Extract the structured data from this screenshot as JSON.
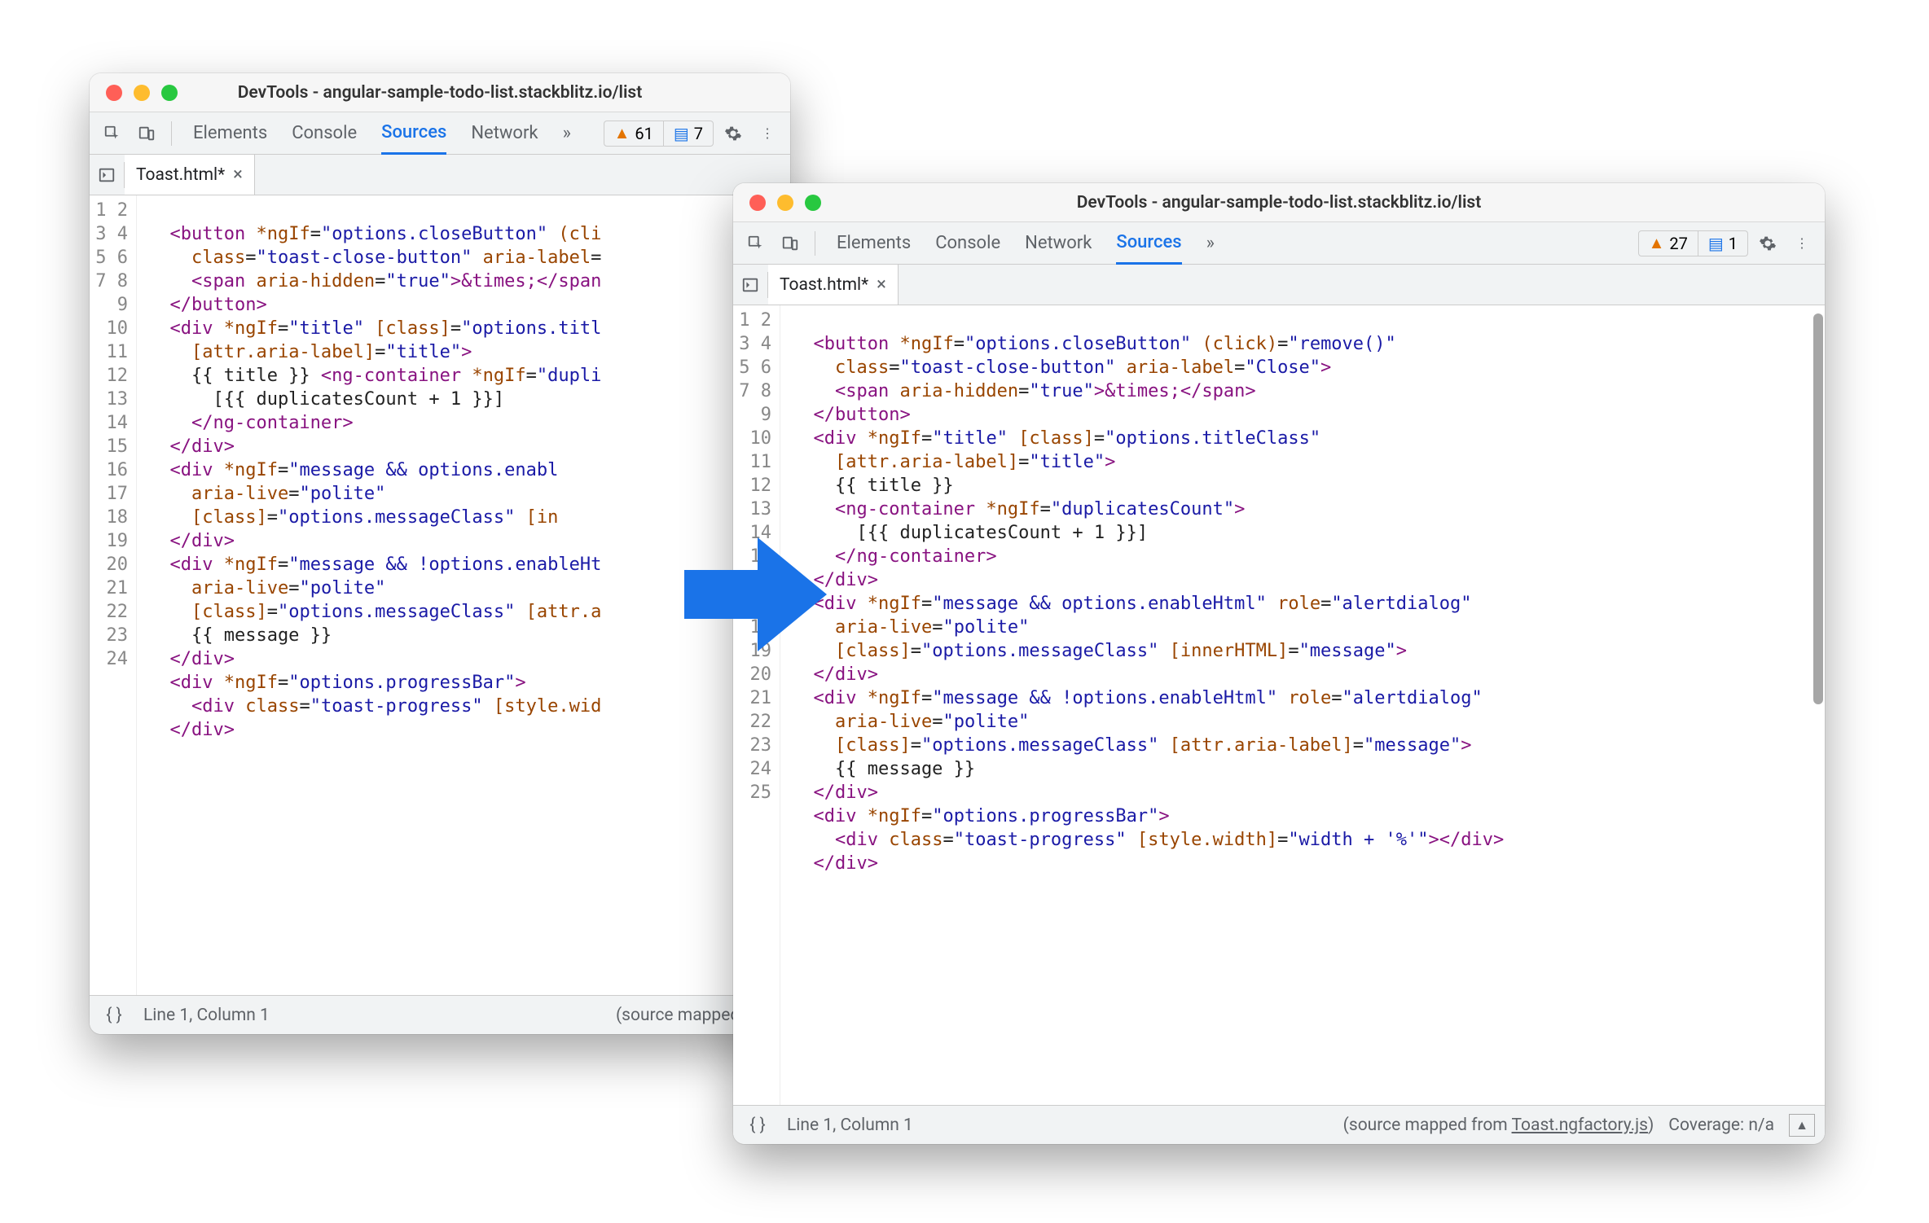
{
  "left": {
    "title": "DevTools - angular-sample-todo-list.stackblitz.io/list",
    "tabs": [
      "Elements",
      "Console",
      "Sources",
      "Network"
    ],
    "activeTab": "Sources",
    "overflow": "»",
    "warnCount": "61",
    "msgCount": "7",
    "fileTab": "Toast.html*",
    "status": {
      "cursor": "Line 1, Column 1",
      "mapped": "(source mapped from "
    },
    "lines": 24,
    "code": [
      [],
      [
        [
          "txt",
          "  "
        ],
        [
          "tag",
          "<button"
        ],
        [
          "txt",
          " "
        ],
        [
          "attr",
          "*ngIf"
        ],
        [
          "txt",
          "="
        ],
        [
          "str",
          "\"options.closeButton\""
        ],
        [
          "txt",
          " "
        ],
        [
          "attr",
          "(cli"
        ]
      ],
      [
        [
          "txt",
          "    "
        ],
        [
          "attr",
          "class"
        ],
        [
          "txt",
          "="
        ],
        [
          "str",
          "\"toast-close-button\""
        ],
        [
          "txt",
          " "
        ],
        [
          "attr",
          "aria-label"
        ],
        [
          "txt",
          "="
        ]
      ],
      [
        [
          "txt",
          "    "
        ],
        [
          "tag",
          "<span"
        ],
        [
          "txt",
          " "
        ],
        [
          "attr",
          "aria-hidden"
        ],
        [
          "txt",
          "="
        ],
        [
          "str",
          "\"true\""
        ],
        [
          "tag",
          ">"
        ],
        [
          "ent",
          "&times;"
        ],
        [
          "tag",
          "</span"
        ]
      ],
      [
        [
          "txt",
          "  "
        ],
        [
          "tag",
          "</button>"
        ]
      ],
      [
        [
          "txt",
          "  "
        ],
        [
          "tag",
          "<div"
        ],
        [
          "txt",
          " "
        ],
        [
          "attr",
          "*ngIf"
        ],
        [
          "txt",
          "="
        ],
        [
          "str",
          "\"title\""
        ],
        [
          "txt",
          " "
        ],
        [
          "attr",
          "[class]"
        ],
        [
          "txt",
          "="
        ],
        [
          "str",
          "\"options.titl"
        ]
      ],
      [
        [
          "txt",
          "    "
        ],
        [
          "attr",
          "[attr.aria-label]"
        ],
        [
          "txt",
          "="
        ],
        [
          "str",
          "\"title\""
        ],
        [
          "tag",
          ">"
        ]
      ],
      [
        [
          "txt",
          "    {{ title }} "
        ],
        [
          "tag",
          "<ng-container"
        ],
        [
          "txt",
          " "
        ],
        [
          "attr",
          "*ngIf"
        ],
        [
          "txt",
          "="
        ],
        [
          "str",
          "\"dupli"
        ]
      ],
      [
        [
          "txt",
          "      [{{ duplicatesCount + 1 }}]"
        ]
      ],
      [
        [
          "txt",
          "    "
        ],
        [
          "tag",
          "</ng-container>"
        ]
      ],
      [
        [
          "txt",
          "  "
        ],
        [
          "tag",
          "</div>"
        ]
      ],
      [
        [
          "txt",
          "  "
        ],
        [
          "tag",
          "<div"
        ],
        [
          "txt",
          " "
        ],
        [
          "attr",
          "*ngIf"
        ],
        [
          "txt",
          "="
        ],
        [
          "str",
          "\"message && options.enabl"
        ]
      ],
      [
        [
          "txt",
          "    "
        ],
        [
          "attr",
          "aria-live"
        ],
        [
          "txt",
          "="
        ],
        [
          "str",
          "\"polite\""
        ]
      ],
      [
        [
          "txt",
          "    "
        ],
        [
          "attr",
          "[class]"
        ],
        [
          "txt",
          "="
        ],
        [
          "str",
          "\"options.messageClass\""
        ],
        [
          "txt",
          " "
        ],
        [
          "attr",
          "[in"
        ]
      ],
      [
        [
          "txt",
          "  "
        ],
        [
          "tag",
          "</div>"
        ]
      ],
      [
        [
          "txt",
          "  "
        ],
        [
          "tag",
          "<div"
        ],
        [
          "txt",
          " "
        ],
        [
          "attr",
          "*ngIf"
        ],
        [
          "txt",
          "="
        ],
        [
          "str",
          "\"message && !options.enableHt"
        ]
      ],
      [
        [
          "txt",
          "    "
        ],
        [
          "attr",
          "aria-live"
        ],
        [
          "txt",
          "="
        ],
        [
          "str",
          "\"polite\""
        ]
      ],
      [
        [
          "txt",
          "    "
        ],
        [
          "attr",
          "[class]"
        ],
        [
          "txt",
          "="
        ],
        [
          "str",
          "\"options.messageClass\""
        ],
        [
          "txt",
          " "
        ],
        [
          "attr",
          "[attr.a"
        ]
      ],
      [
        [
          "txt",
          "    {{ message }}"
        ]
      ],
      [
        [
          "txt",
          "  "
        ],
        [
          "tag",
          "</div>"
        ]
      ],
      [
        [
          "txt",
          "  "
        ],
        [
          "tag",
          "<div"
        ],
        [
          "txt",
          " "
        ],
        [
          "attr",
          "*ngIf"
        ],
        [
          "txt",
          "="
        ],
        [
          "str",
          "\"options.progressBar\""
        ],
        [
          "tag",
          ">"
        ]
      ],
      [
        [
          "txt",
          "    "
        ],
        [
          "tag",
          "<div"
        ],
        [
          "txt",
          " "
        ],
        [
          "attr",
          "class"
        ],
        [
          "txt",
          "="
        ],
        [
          "str",
          "\"toast-progress\""
        ],
        [
          "txt",
          " "
        ],
        [
          "attr",
          "[style.wid"
        ]
      ],
      [
        [
          "txt",
          "  "
        ],
        [
          "tag",
          "</div>"
        ]
      ],
      []
    ]
  },
  "right": {
    "title": "DevTools - angular-sample-todo-list.stackblitz.io/list",
    "tabs": [
      "Elements",
      "Console",
      "Network",
      "Sources"
    ],
    "activeTab": "Sources",
    "overflow": "»",
    "warnCount": "27",
    "msgCount": "1",
    "fileTab": "Toast.html*",
    "status": {
      "cursor": "Line 1, Column 1",
      "mappedPrefix": "(source mapped from ",
      "mappedLink": "Toast.ngfactory.js",
      "mappedSuffix": ")",
      "coverage": "Coverage: n/a"
    },
    "lines": 25,
    "code": [
      [],
      [
        [
          "txt",
          "  "
        ],
        [
          "tag",
          "<button"
        ],
        [
          "txt",
          " "
        ],
        [
          "attr",
          "*ngIf"
        ],
        [
          "txt",
          "="
        ],
        [
          "str",
          "\"options.closeButton\""
        ],
        [
          "txt",
          " "
        ],
        [
          "attr",
          "(click)"
        ],
        [
          "txt",
          "="
        ],
        [
          "str",
          "\"remove()\""
        ]
      ],
      [
        [
          "txt",
          "    "
        ],
        [
          "attr",
          "class"
        ],
        [
          "txt",
          "="
        ],
        [
          "str",
          "\"toast-close-button\""
        ],
        [
          "txt",
          " "
        ],
        [
          "attr",
          "aria-label"
        ],
        [
          "txt",
          "="
        ],
        [
          "str",
          "\"Close\""
        ],
        [
          "tag",
          ">"
        ]
      ],
      [
        [
          "txt",
          "    "
        ],
        [
          "tag",
          "<span"
        ],
        [
          "txt",
          " "
        ],
        [
          "attr",
          "aria-hidden"
        ],
        [
          "txt",
          "="
        ],
        [
          "str",
          "\"true\""
        ],
        [
          "tag",
          ">"
        ],
        [
          "ent",
          "&times;"
        ],
        [
          "tag",
          "</span>"
        ]
      ],
      [
        [
          "txt",
          "  "
        ],
        [
          "tag",
          "</button>"
        ]
      ],
      [
        [
          "txt",
          "  "
        ],
        [
          "tag",
          "<div"
        ],
        [
          "txt",
          " "
        ],
        [
          "attr",
          "*ngIf"
        ],
        [
          "txt",
          "="
        ],
        [
          "str",
          "\"title\""
        ],
        [
          "txt",
          " "
        ],
        [
          "attr",
          "[class]"
        ],
        [
          "txt",
          "="
        ],
        [
          "str",
          "\"options.titleClass\""
        ]
      ],
      [
        [
          "txt",
          "    "
        ],
        [
          "attr",
          "[attr.aria-label]"
        ],
        [
          "txt",
          "="
        ],
        [
          "str",
          "\"title\""
        ],
        [
          "tag",
          ">"
        ]
      ],
      [
        [
          "txt",
          "    {{ title }}"
        ]
      ],
      [
        [
          "txt",
          "    "
        ],
        [
          "tag",
          "<ng-container"
        ],
        [
          "txt",
          " "
        ],
        [
          "attr",
          "*ngIf"
        ],
        [
          "txt",
          "="
        ],
        [
          "str",
          "\"duplicatesCount\""
        ],
        [
          "tag",
          ">"
        ]
      ],
      [
        [
          "txt",
          "      [{{ duplicatesCount + 1 }}]"
        ]
      ],
      [
        [
          "txt",
          "    "
        ],
        [
          "tag",
          "</ng-container>"
        ]
      ],
      [
        [
          "txt",
          "  "
        ],
        [
          "tag",
          "</div>"
        ]
      ],
      [
        [
          "txt",
          "  "
        ],
        [
          "tag",
          "<div"
        ],
        [
          "txt",
          " "
        ],
        [
          "attr",
          "*ngIf"
        ],
        [
          "txt",
          "="
        ],
        [
          "str",
          "\"message && options.enableHtml\""
        ],
        [
          "txt",
          " "
        ],
        [
          "attr",
          "role"
        ],
        [
          "txt",
          "="
        ],
        [
          "str",
          "\"alertdialog\""
        ]
      ],
      [
        [
          "txt",
          "    "
        ],
        [
          "attr",
          "aria-live"
        ],
        [
          "txt",
          "="
        ],
        [
          "str",
          "\"polite\""
        ]
      ],
      [
        [
          "txt",
          "    "
        ],
        [
          "attr",
          "[class]"
        ],
        [
          "txt",
          "="
        ],
        [
          "str",
          "\"options.messageClass\""
        ],
        [
          "txt",
          " "
        ],
        [
          "attr",
          "[innerHTML]"
        ],
        [
          "txt",
          "="
        ],
        [
          "str",
          "\"message\""
        ],
        [
          "tag",
          ">"
        ]
      ],
      [
        [
          "txt",
          "  "
        ],
        [
          "tag",
          "</div>"
        ]
      ],
      [
        [
          "txt",
          "  "
        ],
        [
          "tag",
          "<div"
        ],
        [
          "txt",
          " "
        ],
        [
          "attr",
          "*ngIf"
        ],
        [
          "txt",
          "="
        ],
        [
          "str",
          "\"message && !options.enableHtml\""
        ],
        [
          "txt",
          " "
        ],
        [
          "attr",
          "role"
        ],
        [
          "txt",
          "="
        ],
        [
          "str",
          "\"alertdialog\""
        ]
      ],
      [
        [
          "txt",
          "    "
        ],
        [
          "attr",
          "aria-live"
        ],
        [
          "txt",
          "="
        ],
        [
          "str",
          "\"polite\""
        ]
      ],
      [
        [
          "txt",
          "    "
        ],
        [
          "attr",
          "[class]"
        ],
        [
          "txt",
          "="
        ],
        [
          "str",
          "\"options.messageClass\""
        ],
        [
          "txt",
          " "
        ],
        [
          "attr",
          "[attr.aria-label]"
        ],
        [
          "txt",
          "="
        ],
        [
          "str",
          "\"message\""
        ],
        [
          "tag",
          ">"
        ]
      ],
      [
        [
          "txt",
          "    {{ message }}"
        ]
      ],
      [
        [
          "txt",
          "  "
        ],
        [
          "tag",
          "</div>"
        ]
      ],
      [
        [
          "txt",
          "  "
        ],
        [
          "tag",
          "<div"
        ],
        [
          "txt",
          " "
        ],
        [
          "attr",
          "*ngIf"
        ],
        [
          "txt",
          "="
        ],
        [
          "str",
          "\"options.progressBar\""
        ],
        [
          "tag",
          ">"
        ]
      ],
      [
        [
          "txt",
          "    "
        ],
        [
          "tag",
          "<div"
        ],
        [
          "txt",
          " "
        ],
        [
          "attr",
          "class"
        ],
        [
          "txt",
          "="
        ],
        [
          "str",
          "\"toast-progress\""
        ],
        [
          "txt",
          " "
        ],
        [
          "attr",
          "[style.width]"
        ],
        [
          "txt",
          "="
        ],
        [
          "str",
          "\"width + '%'\""
        ],
        [
          "tag",
          "></div>"
        ]
      ],
      [
        [
          "txt",
          "  "
        ],
        [
          "tag",
          "</div>"
        ]
      ],
      []
    ]
  }
}
